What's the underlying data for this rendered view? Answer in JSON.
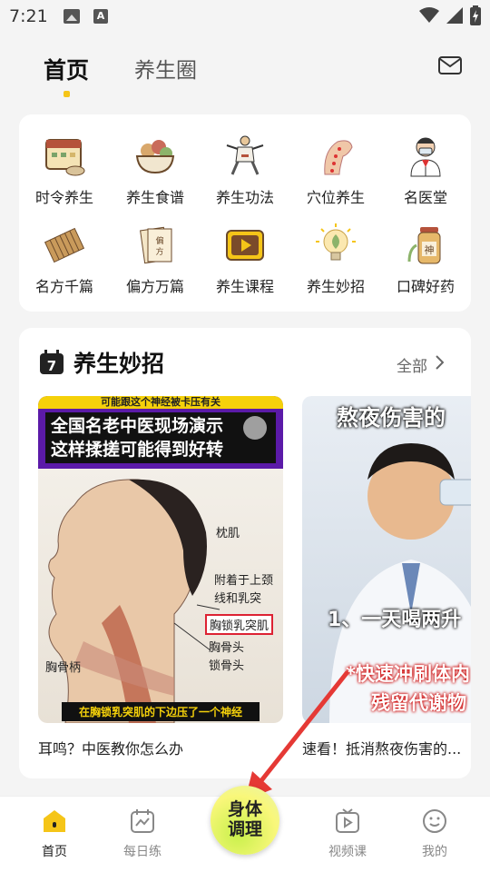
{
  "status_bar": {
    "time": "7:21",
    "a_icon_letter": "A"
  },
  "header": {
    "tabs": [
      {
        "label": "首页",
        "active": true
      },
      {
        "label": "养生圈",
        "active": false
      }
    ],
    "mail_icon": "mail-icon"
  },
  "categories": [
    {
      "label": "时令养生",
      "icon": "calendar-bowl-icon"
    },
    {
      "label": "养生食谱",
      "icon": "food-bowl-icon"
    },
    {
      "label": "养生功法",
      "icon": "taichi-figure-icon"
    },
    {
      "label": "穴位养生",
      "icon": "acupoint-body-icon"
    },
    {
      "label": "名医堂",
      "icon": "doctor-icon"
    },
    {
      "label": "名方千篇",
      "icon": "bamboo-scroll-icon"
    },
    {
      "label": "偏方万篇",
      "icon": "prescription-paper-icon"
    },
    {
      "label": "养生课程",
      "icon": "video-course-icon"
    },
    {
      "label": "养生妙招",
      "icon": "lightbulb-icon"
    },
    {
      "label": "口碑好药",
      "icon": "medicine-jar-icon"
    }
  ],
  "tips": {
    "title": "养生妙招",
    "calendar_day": "7",
    "all_label": "全部",
    "videos": [
      {
        "title": "耳鸣？中医教你怎么办",
        "thumb_strip": "可能跟这个神经被卡压有关",
        "thumb_headline_1": "全国名老中医现场演示",
        "thumb_headline_2": "这样揉搓可能得到好转",
        "labels": [
          "枕肌",
          "附着于上颈",
          "线和乳突",
          "胸锁乳突肌",
          "胸骨头",
          "锁骨头",
          "胸骨柄"
        ],
        "caption": "在胸锁乳突肌的下边压了一个神经"
      },
      {
        "title": "速看！抵消熬夜伤害的...",
        "thumb_title": "熬夜伤害的",
        "thumb_sub": "1、一天喝两升",
        "thumb_hl1": "*快速冲刷体内",
        "thumb_hl2": "残留代谢物"
      }
    ]
  },
  "bottom_nav": {
    "items": [
      {
        "label": "首页",
        "icon": "home-icon",
        "active": true
      },
      {
        "label": "每日练",
        "icon": "daily-practice-icon",
        "active": false
      },
      {
        "label": "视频课",
        "icon": "video-tv-icon",
        "active": false
      },
      {
        "label": "我的",
        "icon": "smiley-icon",
        "active": false
      }
    ],
    "center_line1": "身体",
    "center_line2": "调理"
  },
  "colors": {
    "accent": "#f5c518",
    "annotation_arrow": "#e53935"
  }
}
